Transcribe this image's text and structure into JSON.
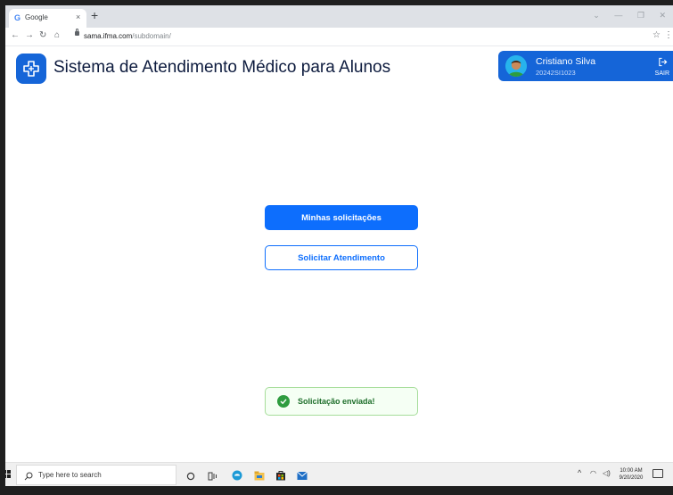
{
  "browser": {
    "tab_title": "Google",
    "tab_favicon": "G",
    "tab_close": "×",
    "new_tab": "+",
    "url_host": "sama.ifma.com",
    "url_path": "/subdomain/",
    "icons": [
      "back-icon",
      "forward-icon",
      "reload-icon",
      "home-icon",
      "lock-icon",
      "star-icon",
      "menu-icon"
    ]
  },
  "header": {
    "title": "Sistema de Atendimento Médico para Alunos",
    "logo_icon": "medical-cross-icon"
  },
  "user": {
    "name": "Cristiano Silva",
    "id": "20242SI1023",
    "logout_label": "SAIR"
  },
  "actions": {
    "my_requests": "Minhas solicitações",
    "request_appointment": "Solicitar Atendimento"
  },
  "toast": {
    "message": "Solicitação enviada!",
    "icon": "check-circle-icon"
  },
  "taskbar": {
    "search_placeholder": "Type here to search",
    "time": "10:00 AM",
    "date": "9/20/2020"
  },
  "colors": {
    "primary": "#1565d8",
    "button": "#0d6efd",
    "success": "#2e9c3f",
    "title": "#0d1b3e"
  }
}
